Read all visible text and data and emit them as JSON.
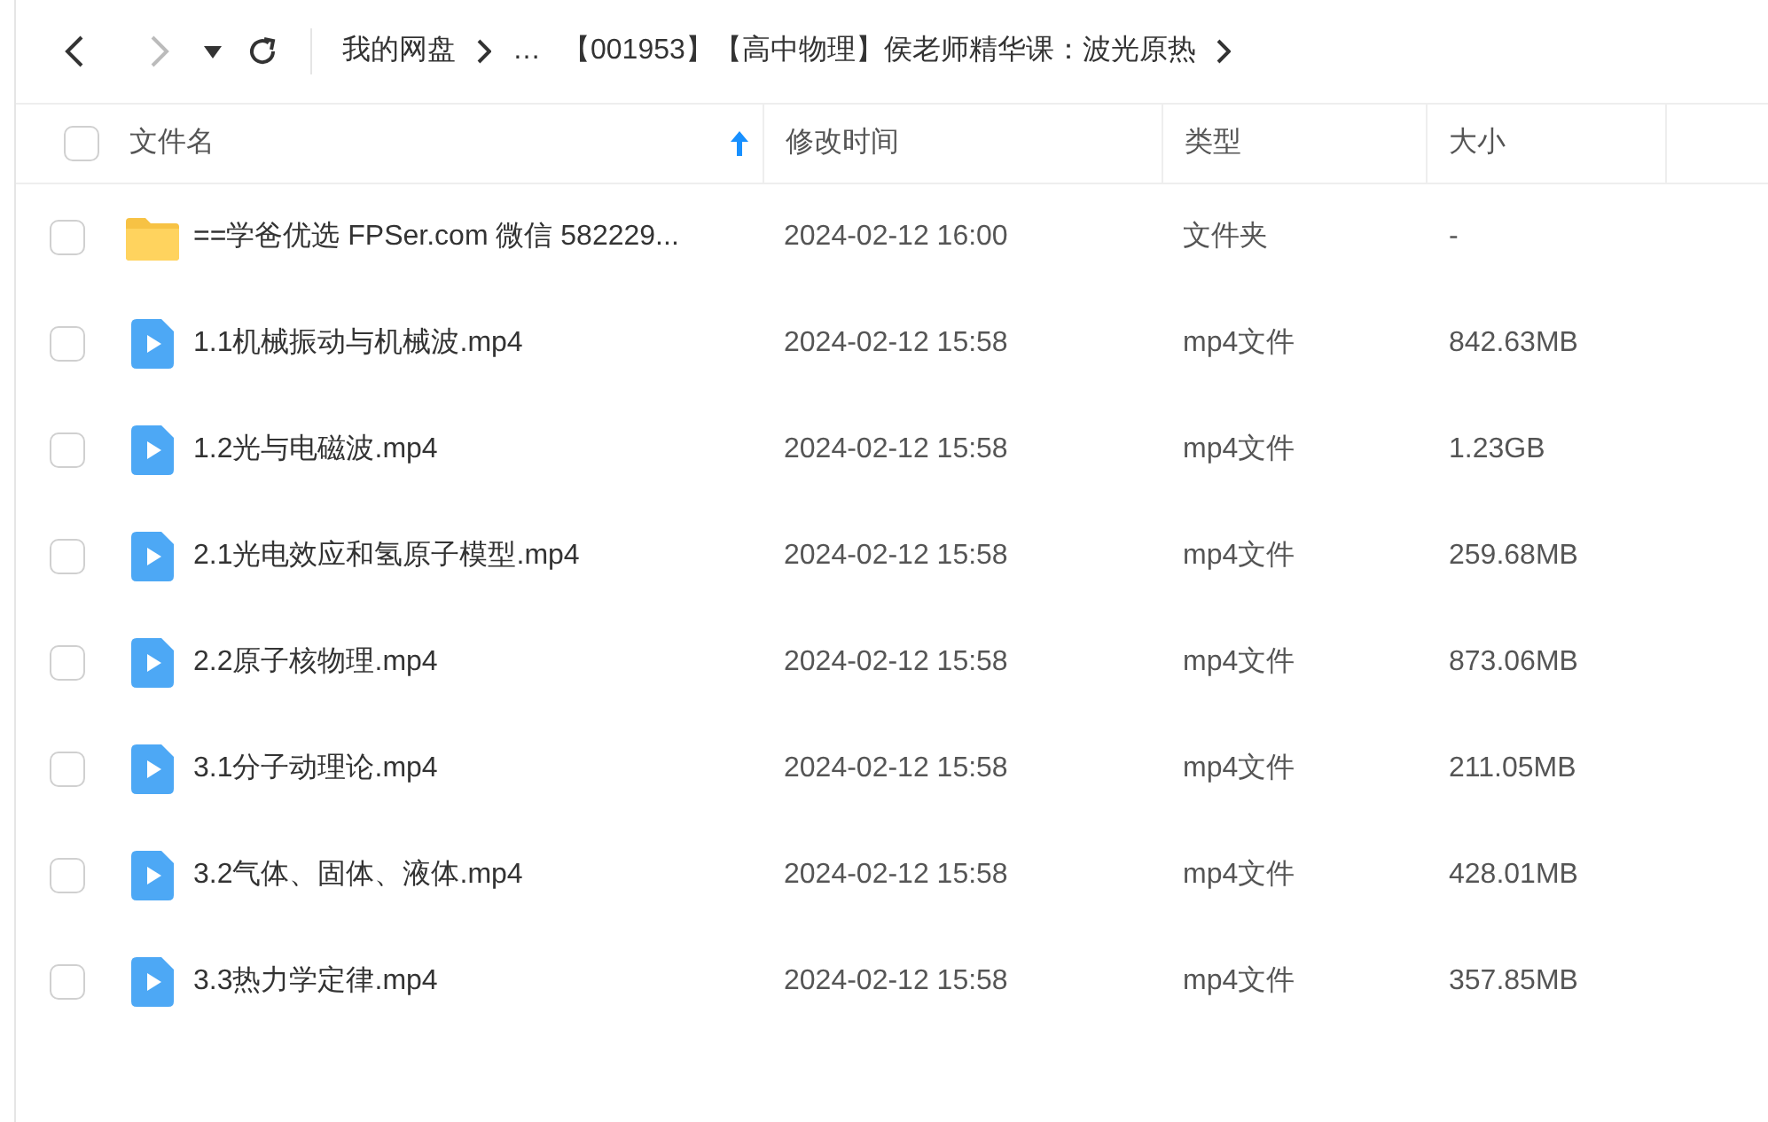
{
  "breadcrumb": [
    {
      "label": "我的网盘",
      "separator_after": true
    },
    {
      "label": "…",
      "separator_after": false
    },
    {
      "label": "【001953】【高中物理】侯老师精华课：波光原热",
      "separator_after": true
    }
  ],
  "columns": [
    {
      "label": "文件名",
      "sorted": true
    },
    {
      "label": "修改时间",
      "sorted": false
    },
    {
      "label": "类型",
      "sorted": false
    },
    {
      "label": "大小",
      "sorted": false
    }
  ],
  "header_checked": false,
  "rows": [
    {
      "kind": "folder",
      "name": "==学爸优选 FPSer.com 微信 582229...",
      "modified": "2024-02-12 16:00",
      "type": "文件夹",
      "size": "-",
      "checked": false
    },
    {
      "kind": "video",
      "name": "1.1机械振动与机械波.mp4",
      "modified": "2024-02-12 15:58",
      "type": "mp4文件",
      "size": "842.63MB",
      "checked": false
    },
    {
      "kind": "video",
      "name": "1.2光与电磁波.mp4",
      "modified": "2024-02-12 15:58",
      "type": "mp4文件",
      "size": "1.23GB",
      "checked": false
    },
    {
      "kind": "video",
      "name": "2.1光电效应和氢原子模型.mp4",
      "modified": "2024-02-12 15:58",
      "type": "mp4文件",
      "size": "259.68MB",
      "checked": false
    },
    {
      "kind": "video",
      "name": "2.2原子核物理.mp4",
      "modified": "2024-02-12 15:58",
      "type": "mp4文件",
      "size": "873.06MB",
      "checked": false
    },
    {
      "kind": "video",
      "name": "3.1分子动理论.mp4",
      "modified": "2024-02-12 15:58",
      "type": "mp4文件",
      "size": "211.05MB",
      "checked": false
    },
    {
      "kind": "video",
      "name": "3.2气体、固体、液体.mp4",
      "modified": "2024-02-12 15:58",
      "type": "mp4文件",
      "size": "428.01MB",
      "checked": false
    },
    {
      "kind": "video",
      "name": "3.3热力学定律.mp4",
      "modified": "2024-02-12 15:58",
      "type": "mp4文件",
      "size": "357.85MB",
      "checked": false
    }
  ]
}
